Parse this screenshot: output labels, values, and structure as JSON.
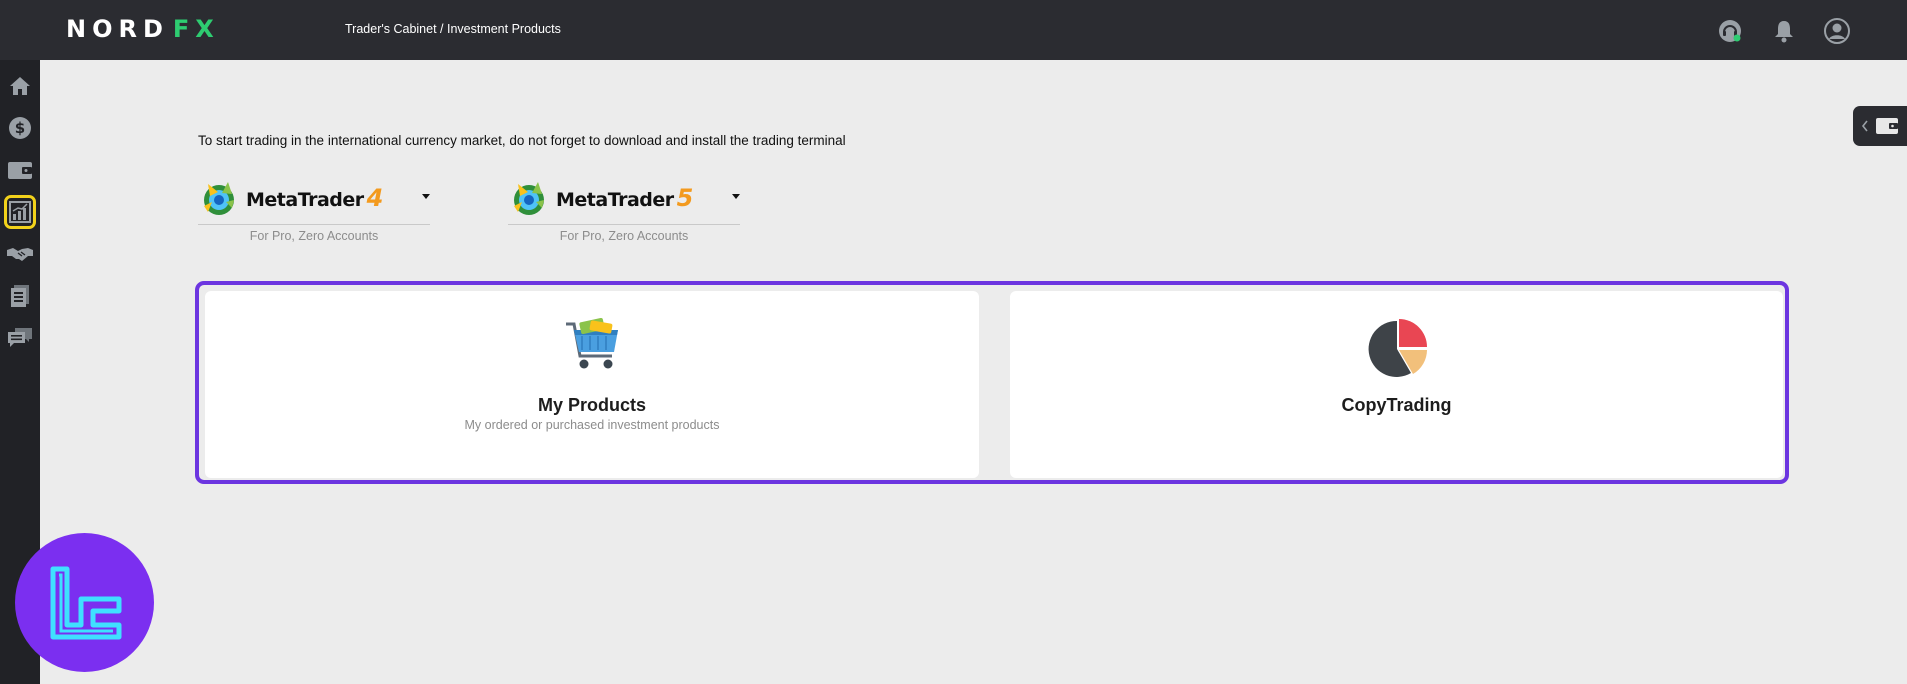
{
  "header": {
    "brand_left": "NORD",
    "brand_right": "FX",
    "breadcrumb": "Trader's Cabinet / Investment Products",
    "icons": [
      "support-headset-icon",
      "bell-icon",
      "user-avatar-icon"
    ]
  },
  "sidebar": {
    "items": [
      {
        "name": "home-icon",
        "active": false
      },
      {
        "name": "dollar-icon",
        "active": false
      },
      {
        "name": "wallet-icon",
        "active": false
      },
      {
        "name": "investment-chart-icon",
        "active": true
      },
      {
        "name": "handshake-icon",
        "active": false
      },
      {
        "name": "documents-icon",
        "active": false
      },
      {
        "name": "chat-icon",
        "active": false
      }
    ],
    "active_color": "#f2d21b"
  },
  "main": {
    "notice": "To start trading in the international currency market, do not forget to download and install the trading terminal",
    "terminals": [
      {
        "name": "MetaTrader",
        "version": "4",
        "subtitle": "For Pro, Zero Accounts"
      },
      {
        "name": "MetaTrader",
        "version": "5",
        "subtitle": "For Pro, Zero Accounts"
      }
    ],
    "cards": [
      {
        "title": "My Products",
        "description": "My ordered or purchased investment products",
        "icon": "shopping-cart-icon"
      },
      {
        "title": "CopyTrading",
        "description": "",
        "icon": "pie-chart-icon"
      }
    ]
  },
  "colors": {
    "topbar": "#2b2c31",
    "sidebar": "#212226",
    "highlight_frame": "#6c35e0",
    "brand_accent": "#2ecc71",
    "mt_version": "#f39a1e"
  }
}
